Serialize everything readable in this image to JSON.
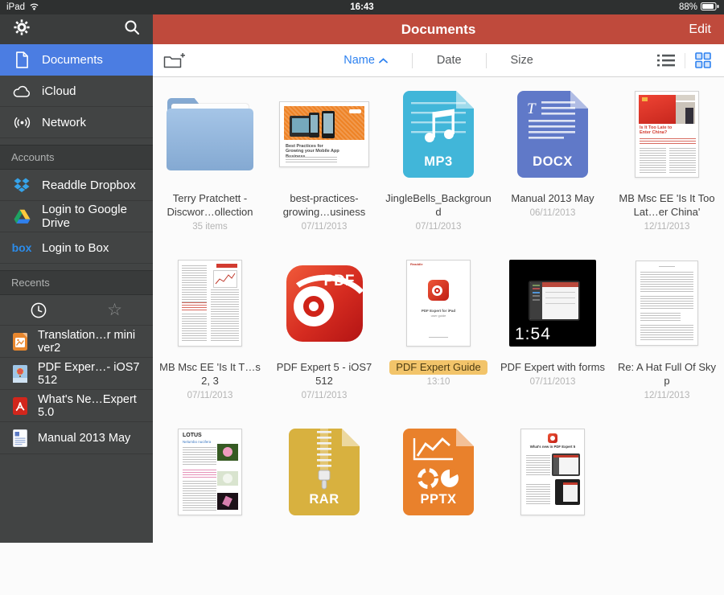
{
  "colors": {
    "accent_red": "#bf4a3c",
    "selection_blue": "#4b7de2",
    "link_blue": "#2e82f0",
    "highlight_orange": "#f2c46a"
  },
  "status_bar": {
    "device": "iPad",
    "time": "16:43",
    "battery_percent": "88%"
  },
  "header": {
    "title": "Documents",
    "edit": "Edit"
  },
  "sidebar": {
    "nav": [
      {
        "label": "Documents"
      },
      {
        "label": "iCloud"
      },
      {
        "label": "Network"
      }
    ],
    "sections": {
      "accounts": "Accounts",
      "recents": "Recents"
    },
    "accounts": [
      {
        "label": "Readdle Dropbox"
      },
      {
        "label": "Login to Google Drive"
      },
      {
        "label": "Login to Box"
      }
    ],
    "recents": [
      {
        "label": "Translation…r mini ver2"
      },
      {
        "label": "PDF Exper…- iOS7 512"
      },
      {
        "label": "What's Ne…Expert 5.0"
      },
      {
        "label": "Manual 2013 May"
      }
    ]
  },
  "toolbar": {
    "sort_name": "Name",
    "sort_date": "Date",
    "sort_size": "Size"
  },
  "grid": {
    "items": [
      {
        "name": "Terry Pratchett - Discwor…ollection",
        "meta": "35 items"
      },
      {
        "name": "best-practices-growing…usiness",
        "meta": "07/11/2013"
      },
      {
        "name": "JingleBells_Background",
        "meta": "07/11/2013"
      },
      {
        "name": "Manual 2013 May",
        "meta": "06/11/2013"
      },
      {
        "name": "MB Msc EE 'Is It Too Lat…er China'",
        "meta": "12/11/2013"
      },
      {
        "name": "MB Msc EE 'Is It T…s 2, 3",
        "meta": "07/11/2013"
      },
      {
        "name": "PDF Expert 5 - iOS7 512",
        "meta": "07/11/2013"
      },
      {
        "name": "PDF Expert Guide",
        "meta": "13:10"
      },
      {
        "name": "PDF Expert with forms",
        "meta": "07/11/2013"
      },
      {
        "name": "Re: A Hat Full Of Sky p",
        "meta": "12/11/2013"
      }
    ],
    "badges": {
      "mp3": "MP3",
      "docx": "DOCX",
      "rar": "RAR",
      "pptx": "PPTX",
      "pdf_app": "PDF"
    },
    "thumb_texts": {
      "video_duration": "1:54",
      "china_title": "Is It Too Late to Enter China?",
      "lotus_title": "LOTUS",
      "lotus_subtitle": "Nelumbo nucifera",
      "bp_title": "Best Practices for Growing your Mobile App Business",
      "guide_line1": "PDF Expert for iPad",
      "guide_line2": "user guide",
      "whatsnew_title": "What's new in PDF Expert 5",
      "readdle": "Readdle"
    }
  }
}
